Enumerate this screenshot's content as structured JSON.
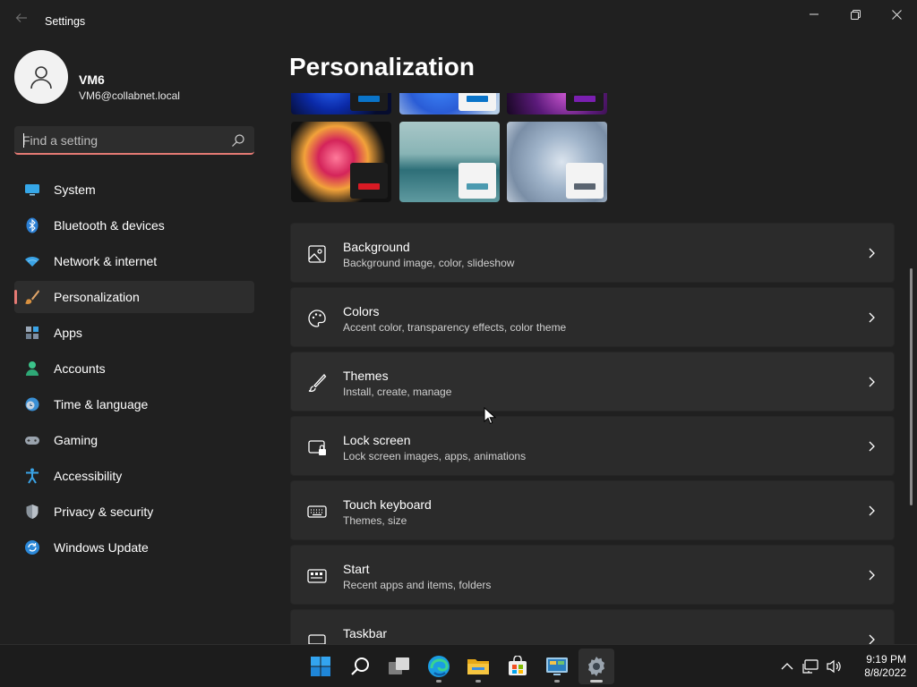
{
  "window": {
    "title": "Settings"
  },
  "profile": {
    "name": "VM6",
    "email": "VM6@collabnet.local"
  },
  "search": {
    "placeholder": "Find a setting"
  },
  "nav": [
    {
      "label": "System",
      "icon": "monitor-icon",
      "active": false
    },
    {
      "label": "Bluetooth & devices",
      "icon": "bluetooth-icon",
      "active": false
    },
    {
      "label": "Network & internet",
      "icon": "wifi-icon",
      "active": false
    },
    {
      "label": "Personalization",
      "icon": "paintbrush-icon",
      "active": true
    },
    {
      "label": "Apps",
      "icon": "apps-icon",
      "active": false
    },
    {
      "label": "Accounts",
      "icon": "person-icon",
      "active": false
    },
    {
      "label": "Time & language",
      "icon": "clock-globe-icon",
      "active": false
    },
    {
      "label": "Gaming",
      "icon": "gamepad-icon",
      "active": false
    },
    {
      "label": "Accessibility",
      "icon": "accessibility-icon",
      "active": false
    },
    {
      "label": "Privacy & security",
      "icon": "shield-icon",
      "active": false
    },
    {
      "label": "Windows Update",
      "icon": "refresh-icon",
      "active": false
    }
  ],
  "main": {
    "title": "Personalization",
    "themes": [
      {
        "name": "theme-bloom-dark",
        "accent": "#0a74c9"
      },
      {
        "name": "theme-bloom-light",
        "accent": "#0a74c9"
      },
      {
        "name": "theme-glow",
        "accent": "#7a1fb0"
      },
      {
        "name": "theme-captured-motion",
        "accent": "#d81a24"
      },
      {
        "name": "theme-sunrise-lake",
        "accent": "#4b9ab0"
      },
      {
        "name": "theme-flow",
        "accent": "#5a6470"
      }
    ],
    "cards": [
      {
        "title": "Background",
        "subtitle": "Background image, color, slideshow",
        "icon": "image-icon"
      },
      {
        "title": "Colors",
        "subtitle": "Accent color, transparency effects, color theme",
        "icon": "palette-icon"
      },
      {
        "title": "Themes",
        "subtitle": "Install, create, manage",
        "icon": "brush-icon"
      },
      {
        "title": "Lock screen",
        "subtitle": "Lock screen images, apps, animations",
        "icon": "lock-screen-icon"
      },
      {
        "title": "Touch keyboard",
        "subtitle": "Themes, size",
        "icon": "keyboard-icon"
      },
      {
        "title": "Start",
        "subtitle": "Recent apps and items, folders",
        "icon": "start-icon"
      },
      {
        "title": "Taskbar",
        "subtitle": "",
        "icon": "taskbar-icon"
      }
    ]
  },
  "taskbar": {
    "apps": [
      "start-icon",
      "search-icon",
      "task-view-icon",
      "edge-icon",
      "file-explorer-icon",
      "store-icon",
      "control-panel-icon",
      "settings-icon"
    ],
    "clock": {
      "time": "9:19 PM",
      "date": "8/8/2022"
    }
  },
  "colors": {
    "accent": "#e57a74",
    "background": "#202020",
    "card": "#2b2b2b"
  }
}
